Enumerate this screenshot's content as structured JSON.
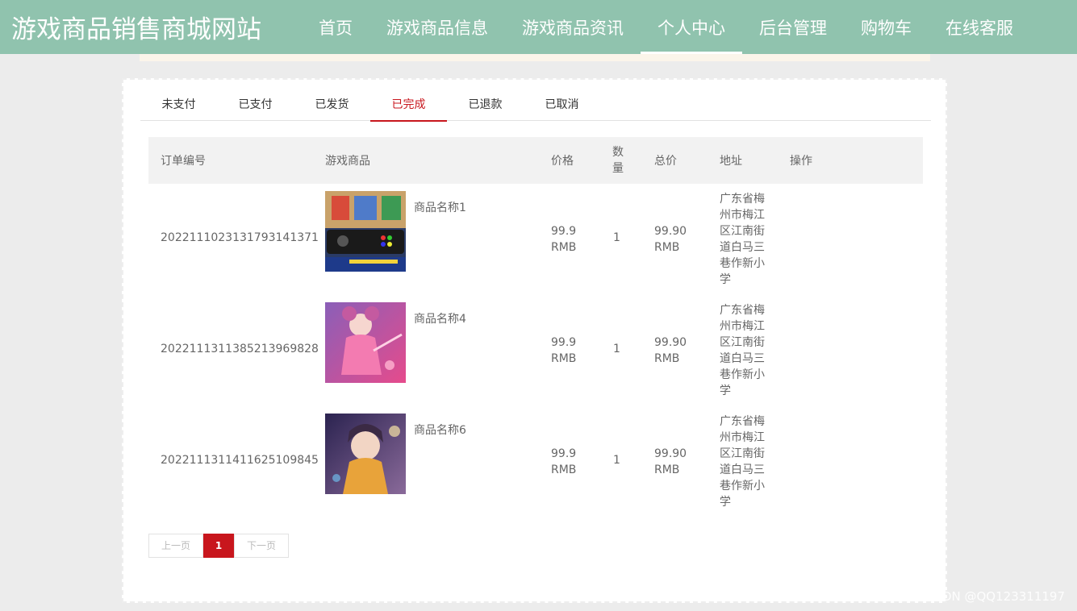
{
  "site": {
    "title": "游戏商品销售商城网站"
  },
  "nav": [
    {
      "label": "首页"
    },
    {
      "label": "游戏商品信息"
    },
    {
      "label": "游戏商品资讯"
    },
    {
      "label": "个人中心",
      "active": true
    },
    {
      "label": "后台管理"
    },
    {
      "label": "购物车"
    },
    {
      "label": "在线客服"
    }
  ],
  "tabs": [
    {
      "label": "未支付"
    },
    {
      "label": "已支付"
    },
    {
      "label": "已发货"
    },
    {
      "label": "已完成",
      "active": true
    },
    {
      "label": "已退款"
    },
    {
      "label": "已取消"
    }
  ],
  "table": {
    "headers": {
      "order_no": "订单编号",
      "product": "游戏商品",
      "price": "价格",
      "qty": "数量",
      "total": "总价",
      "address": "地址",
      "action": "操作"
    },
    "rows": [
      {
        "order_no": "20221110231317931413 71",
        "product_name": "商品名称1",
        "price": "99.9 RMB",
        "qty": "1",
        "total": "99.90 RMB",
        "address": "广东省梅州市梅江区江南街道白马三巷作新小学",
        "thumb_icon": "game-controller-image"
      },
      {
        "order_no": "20221113113852139698 28",
        "product_name": "商品名称4",
        "price": "99.9 RMB",
        "qty": "1",
        "total": "99.90 RMB",
        "address": "广东省梅州市梅江区江南街道白马三巷作新小学",
        "thumb_icon": "anime-girl-pink-image"
      },
      {
        "order_no": "20221113114116251098 45",
        "product_name": "商品名称6",
        "price": "99.9 RMB",
        "qty": "1",
        "total": "99.90 RMB",
        "address": "广东省梅州市梅江区江南街道白马三巷作新小学",
        "thumb_icon": "anime-girl-dark-image"
      }
    ]
  },
  "pager": {
    "prev": "上一页",
    "current": "1",
    "next": "下一页"
  },
  "watermark": "CSDN @QQ123311197",
  "colors": {
    "header_bg": "#90c3ae",
    "accent": "#c8161d",
    "page_bg": "#ececec"
  }
}
